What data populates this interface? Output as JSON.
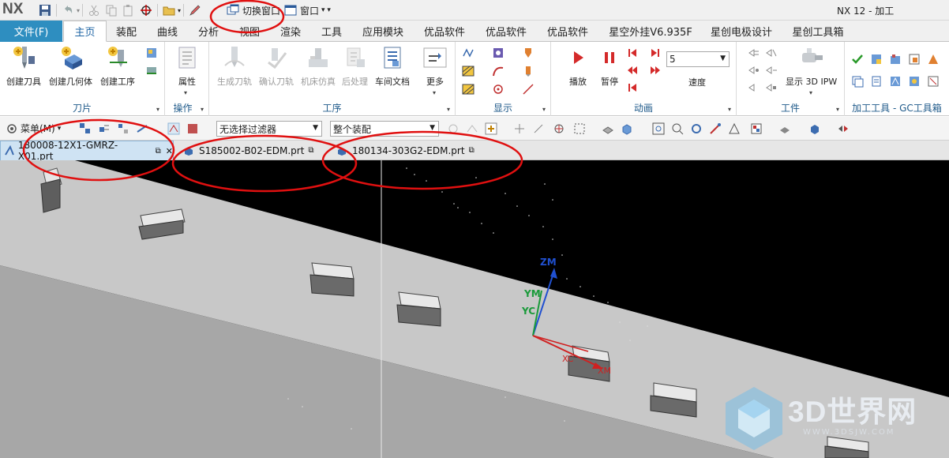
{
  "titlebar": {
    "logo": "NX",
    "switch_window": "切换窗口",
    "window": "窗口",
    "app_title": "NX 12 - 加工"
  },
  "ribbon_tabs": {
    "file": "文件(F)",
    "tabs": [
      "主页",
      "装配",
      "曲线",
      "分析",
      "视图",
      "渲染",
      "工具",
      "应用模块",
      "优品软件",
      "优品软件",
      "优品软件",
      "星空外挂V6.935F",
      "星创电极设计",
      "星创工具箱"
    ],
    "active": "主页"
  },
  "ribbon": {
    "tool_group": {
      "name": "刀片",
      "create_tool": "创建刀具",
      "create_geometry": "创建几何体",
      "create_operation": "创建工序"
    },
    "operations_group": {
      "name": "操作",
      "properties": "属性"
    },
    "process_group": {
      "name": "工序",
      "generate_path": "生成刀轨",
      "verify_path": "确认刀轨",
      "machine_sim": "机床仿真",
      "postprocess": "后处理",
      "shop_doc": "车间文档",
      "more": "更多"
    },
    "display_group": {
      "name": "显示"
    },
    "animation_group": {
      "name": "动画",
      "play": "播放",
      "pause": "暂停",
      "speed_value": "5",
      "speed": "速度"
    },
    "workpiece_group": {
      "name": "工件",
      "show_ipw": "显示 3D IPW"
    },
    "gc_group": {
      "name": "加工工具 - GC工具箱"
    }
  },
  "toolbar2": {
    "menu": "菜单(M)",
    "filter": "无选择过滤器",
    "assembly": "整个装配"
  },
  "doc_tabs": [
    {
      "label": "180008-12X1-GMRZ-X01.prt",
      "active": true
    },
    {
      "label": "S185002-B02-EDM.prt",
      "active": false
    },
    {
      "label": "180134-303G2-EDM.prt",
      "active": false
    }
  ],
  "viewport": {
    "axis_labels": {
      "zm": "ZM",
      "ym": "YM",
      "yc": "YC",
      "xm": "XM",
      "xc": "XC"
    }
  },
  "watermark": {
    "brand": "3D世界网",
    "url": "WWW.3DSJW.COM"
  },
  "colors": {
    "file_tab": "#2e8ec0",
    "annotation": "#e01010",
    "viewport_bg": "#000000",
    "part_top": "#c8c8c8"
  }
}
